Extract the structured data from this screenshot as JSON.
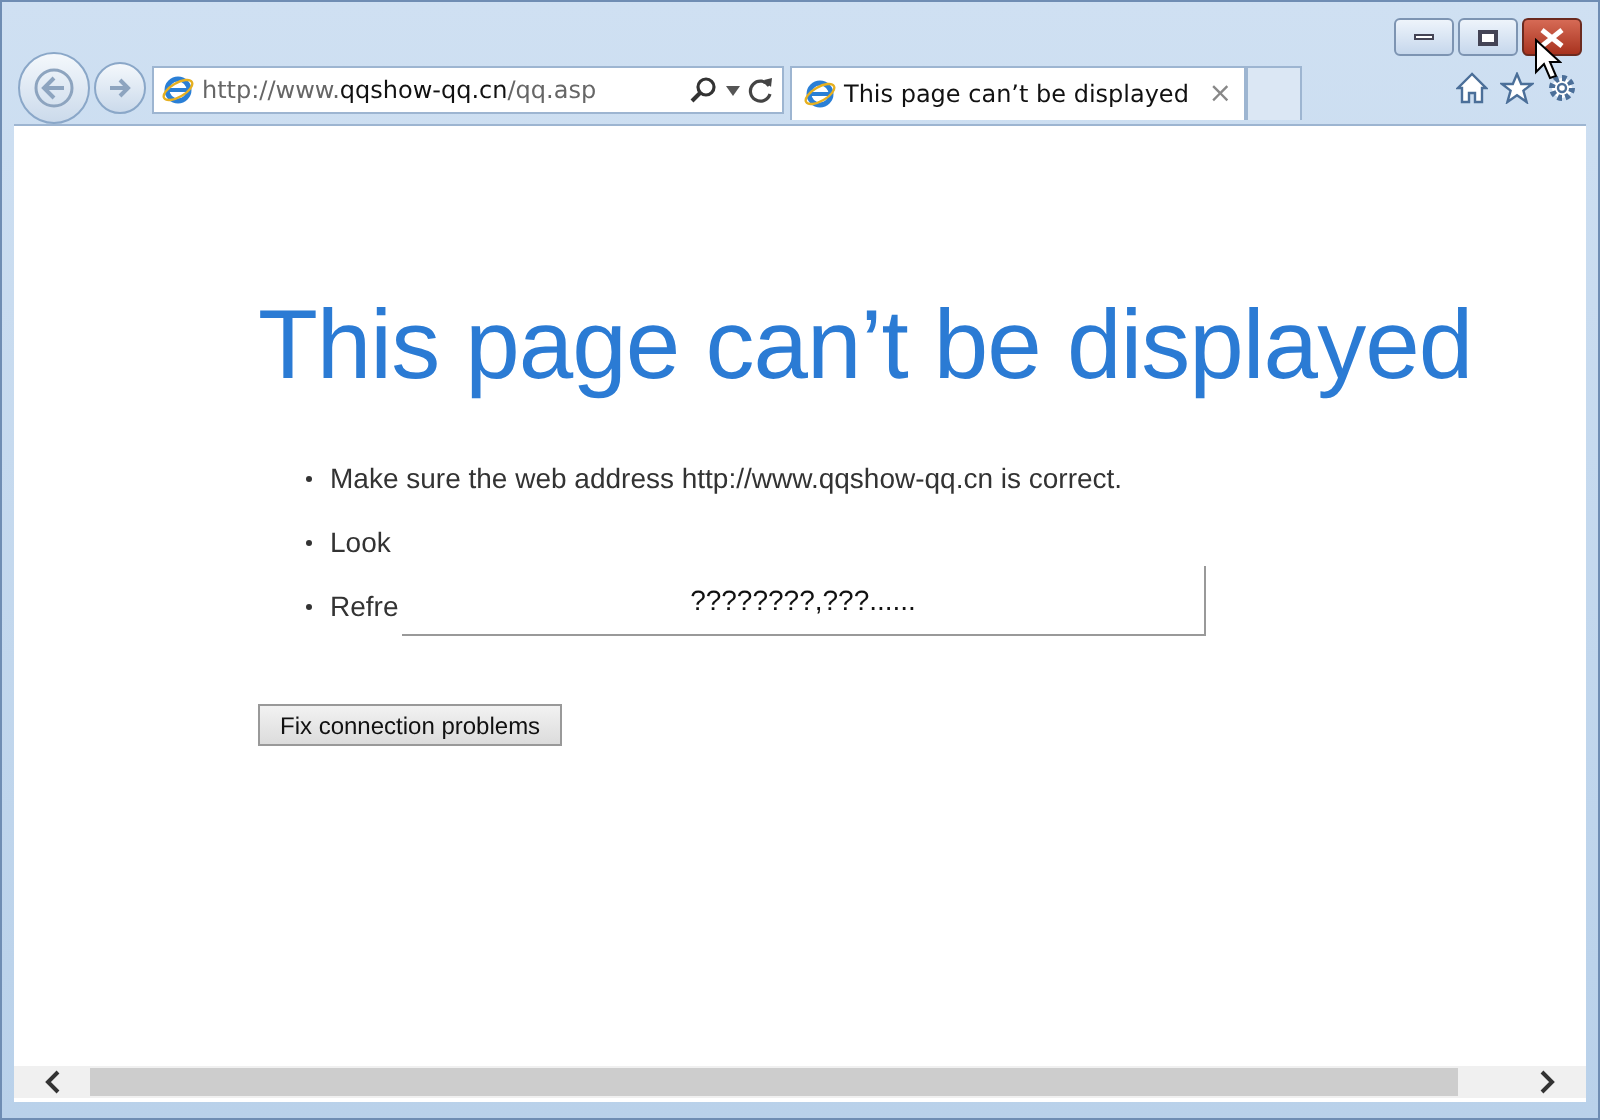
{
  "address_bar": {
    "prefix": "http://www.",
    "domain": "qqshow-qq.cn",
    "suffix": "/qq.asp"
  },
  "tabs": [
    {
      "label": "This page can’t be displayed",
      "close": "×",
      "selected": true
    }
  ],
  "page": {
    "heading": "This page can’t be displayed",
    "bullets": [
      "Make sure the web address http://www.qqshow-qq.cn is correct.",
      "Look",
      "Refre"
    ],
    "button": "Fix connection problems"
  },
  "popup": {
    "text": "????????,???......"
  }
}
